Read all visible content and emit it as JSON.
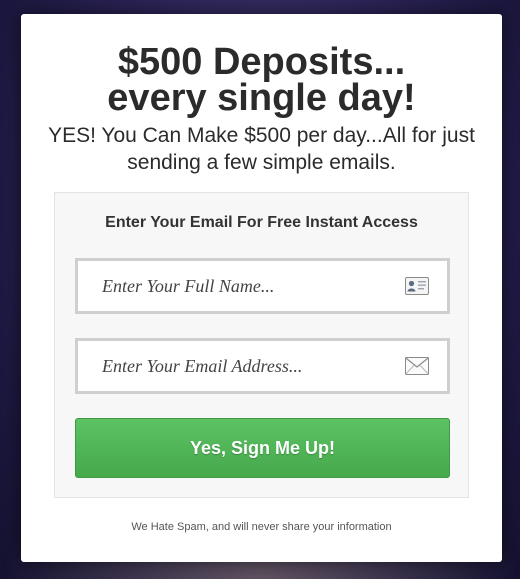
{
  "popup": {
    "headline_line1": "$500 Deposits...",
    "headline_line2": "every single day!",
    "subheadline": "YES! You Can Make $500 per day...All for just sending a few simple emails."
  },
  "form": {
    "title": "Enter Your Email For Free Instant Access",
    "name_field": {
      "placeholder": "Enter Your Full Name...",
      "value": "",
      "icon": "contact-card-icon"
    },
    "email_field": {
      "placeholder": "Enter Your Email Address...",
      "value": "",
      "icon": "envelope-icon"
    },
    "submit_label": "Yes, Sign Me Up!",
    "disclaimer": "We Hate Spam, and will never share your information"
  },
  "colors": {
    "button_green": "#4cb552",
    "headline_text": "#2b2b2b",
    "backdrop": "#2d2558"
  }
}
